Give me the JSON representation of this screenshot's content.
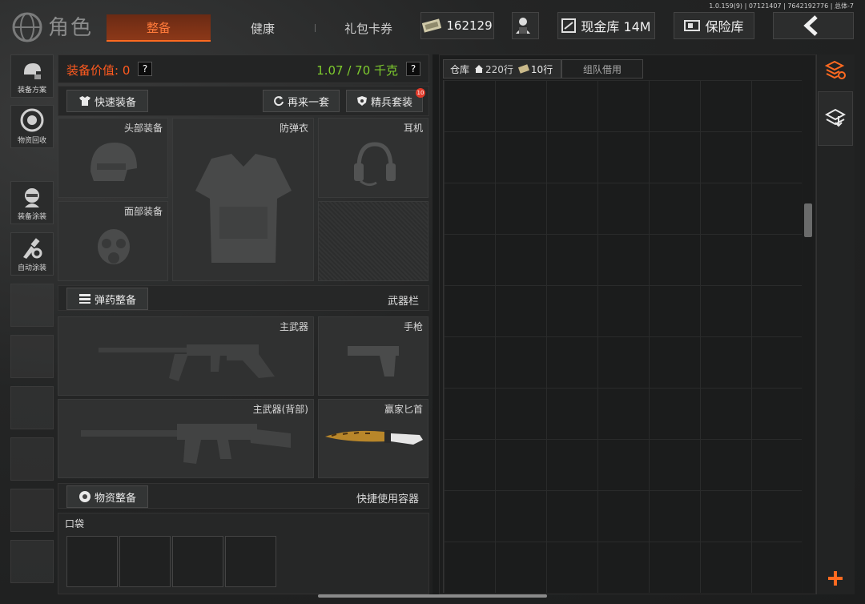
{
  "version_text": "1.0.159(9) | 07121407 | 7642192776 | 总体-7",
  "header": {
    "title": "角色",
    "tabs": [
      {
        "label": "整备",
        "active": true
      },
      {
        "label": "健康",
        "active": false
      },
      {
        "label": "礼包卡券",
        "active": false
      }
    ],
    "currency_value": "162129",
    "cash_vault_label": "现金库 14M",
    "safe_box_label": "保险库"
  },
  "sidebar": {
    "items": [
      {
        "label": "装备方案"
      },
      {
        "label": "物资回收"
      },
      {
        "label": "装备涂装"
      },
      {
        "label": "自动涂装"
      }
    ]
  },
  "equipment": {
    "value_label": "装备价值: 0",
    "help_mark": "?",
    "weight_label": "1.07 / 70 千克",
    "quick_equip_label": "快速装备",
    "again_label": "再来一套",
    "elite_label": "精兵套装",
    "elite_badge": "10",
    "slots": {
      "head": "头部装备",
      "armor": "防弹衣",
      "ears": "耳机",
      "face": "面部装备"
    }
  },
  "weapons": {
    "ammo_button_label": "弹药整备",
    "bar_label": "武器栏",
    "primary": "主武器",
    "pistol": "手枪",
    "primary_back": "主武器(背部)",
    "knife": "赢家匕首"
  },
  "supplies": {
    "button_label": "物资整备",
    "bar_label": "快捷使用容器",
    "pocket_label": "口袋",
    "pocket_count": 4
  },
  "warehouse": {
    "tab_label": "仓库",
    "rows_label": "220行",
    "extra_rows_label": "10行",
    "team_borrow_label": "组队借用"
  },
  "colors": {
    "accent": "#ff6a20",
    "weight_green": "#7ecb2e",
    "value_orange": "#ff5a1f",
    "badge_red": "#e23b2b"
  }
}
